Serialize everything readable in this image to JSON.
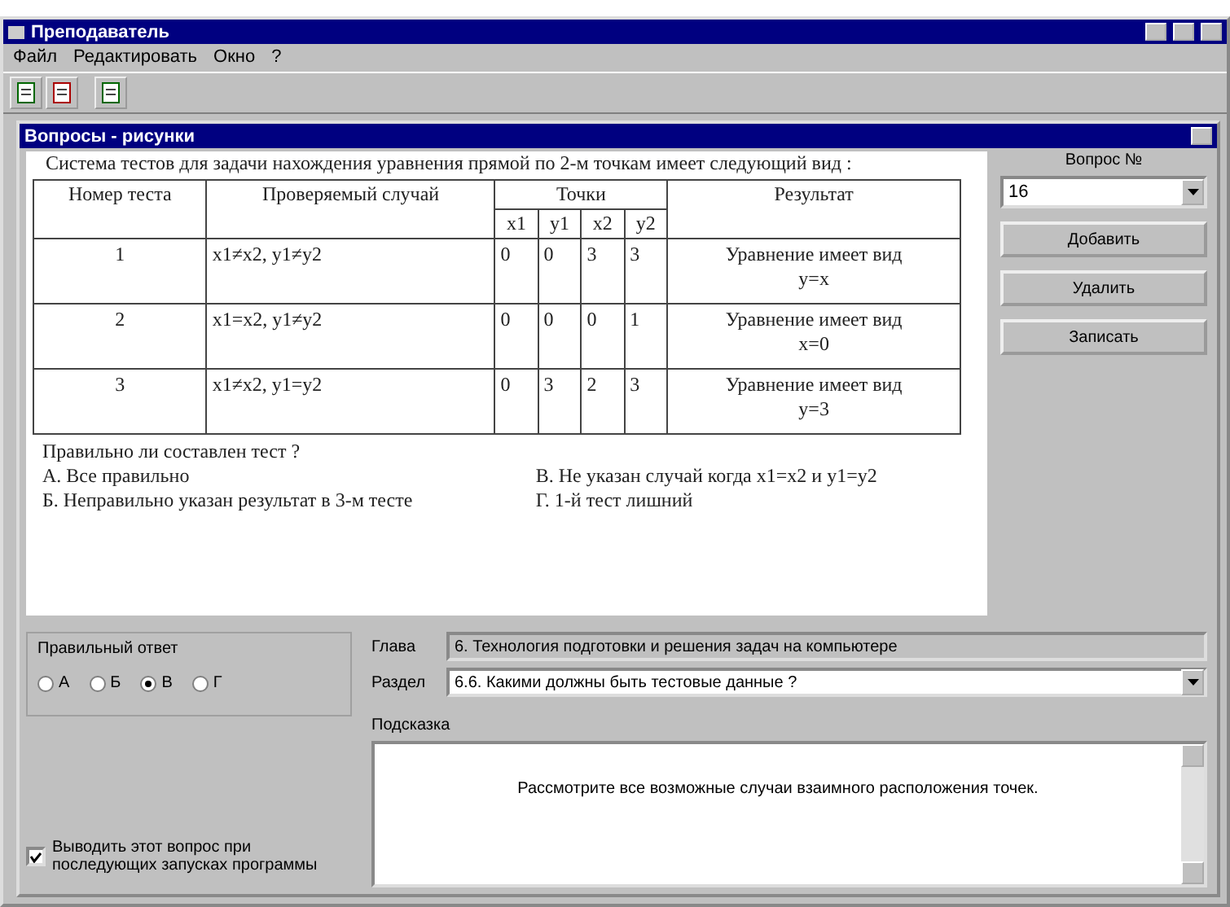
{
  "window": {
    "title": "Преподаватель"
  },
  "menu": [
    {
      "label": "Файл"
    },
    {
      "label": "Редактировать"
    },
    {
      "label": "Окно"
    },
    {
      "label": "?"
    }
  ],
  "child_window": {
    "title": "Вопросы - рисунки"
  },
  "question": {
    "intro": "Система тестов для задачи нахождения уравнения прямой по 2-м точкам имеет следующий вид :",
    "table": {
      "columns": [
        "Номер теста",
        "Проверяемый случай",
        "Точки",
        "Результат"
      ],
      "subcolumns": [
        "x1",
        "y1",
        "x2",
        "y2"
      ],
      "rows": [
        {
          "number": "1",
          "case": "x1≠x2, y1≠y2",
          "points": [
            "0",
            "0",
            "3",
            "3"
          ],
          "result": [
            "Уравнение имеет вид",
            "y=x"
          ]
        },
        {
          "number": "2",
          "case": "x1=x2, y1≠y2",
          "points": [
            "0",
            "0",
            "0",
            "1"
          ],
          "result": [
            "Уравнение имеет вид",
            "x=0"
          ]
        },
        {
          "number": "3",
          "case": "x1≠x2, y1=y2",
          "points": [
            "0",
            "3",
            "2",
            "3"
          ],
          "result": [
            "Уравнение имеет вид",
            "y=3"
          ]
        }
      ]
    },
    "prompt": "Правильно ли составлен тест ?",
    "options_left": [
      "А. Все правильно",
      "Б. Неправильно указан результат в 3-м тесте"
    ],
    "options_right": [
      "В. Не указан случай когда x1=x2 и y1=y2",
      "Г. 1-й тест лишний"
    ]
  },
  "side": {
    "label": "Вопрос №",
    "number": "16",
    "buttons": [
      "Добавить",
      "Удалить",
      "Записать"
    ]
  },
  "answer": {
    "title": "Правильный ответ",
    "choices": [
      {
        "label": "А",
        "selected": false
      },
      {
        "label": "Б",
        "selected": false
      },
      {
        "label": "В",
        "selected": true
      },
      {
        "label": "Г",
        "selected": false
      }
    ]
  },
  "repeat": {
    "label": "Выводить этот вопрос при последующих запусках программы",
    "checked": true
  },
  "chapter": {
    "label": "Глава",
    "value": "6. Технология подготовки и решения задач на компьютере",
    "disabled": true
  },
  "section": {
    "label": "Раздел",
    "value": "6.6. Какими должны быть тестовые данные ?"
  },
  "hint": {
    "label": "Подсказка",
    "value": "Рассмотрите все возможные случаи взаимного расположения точек."
  }
}
